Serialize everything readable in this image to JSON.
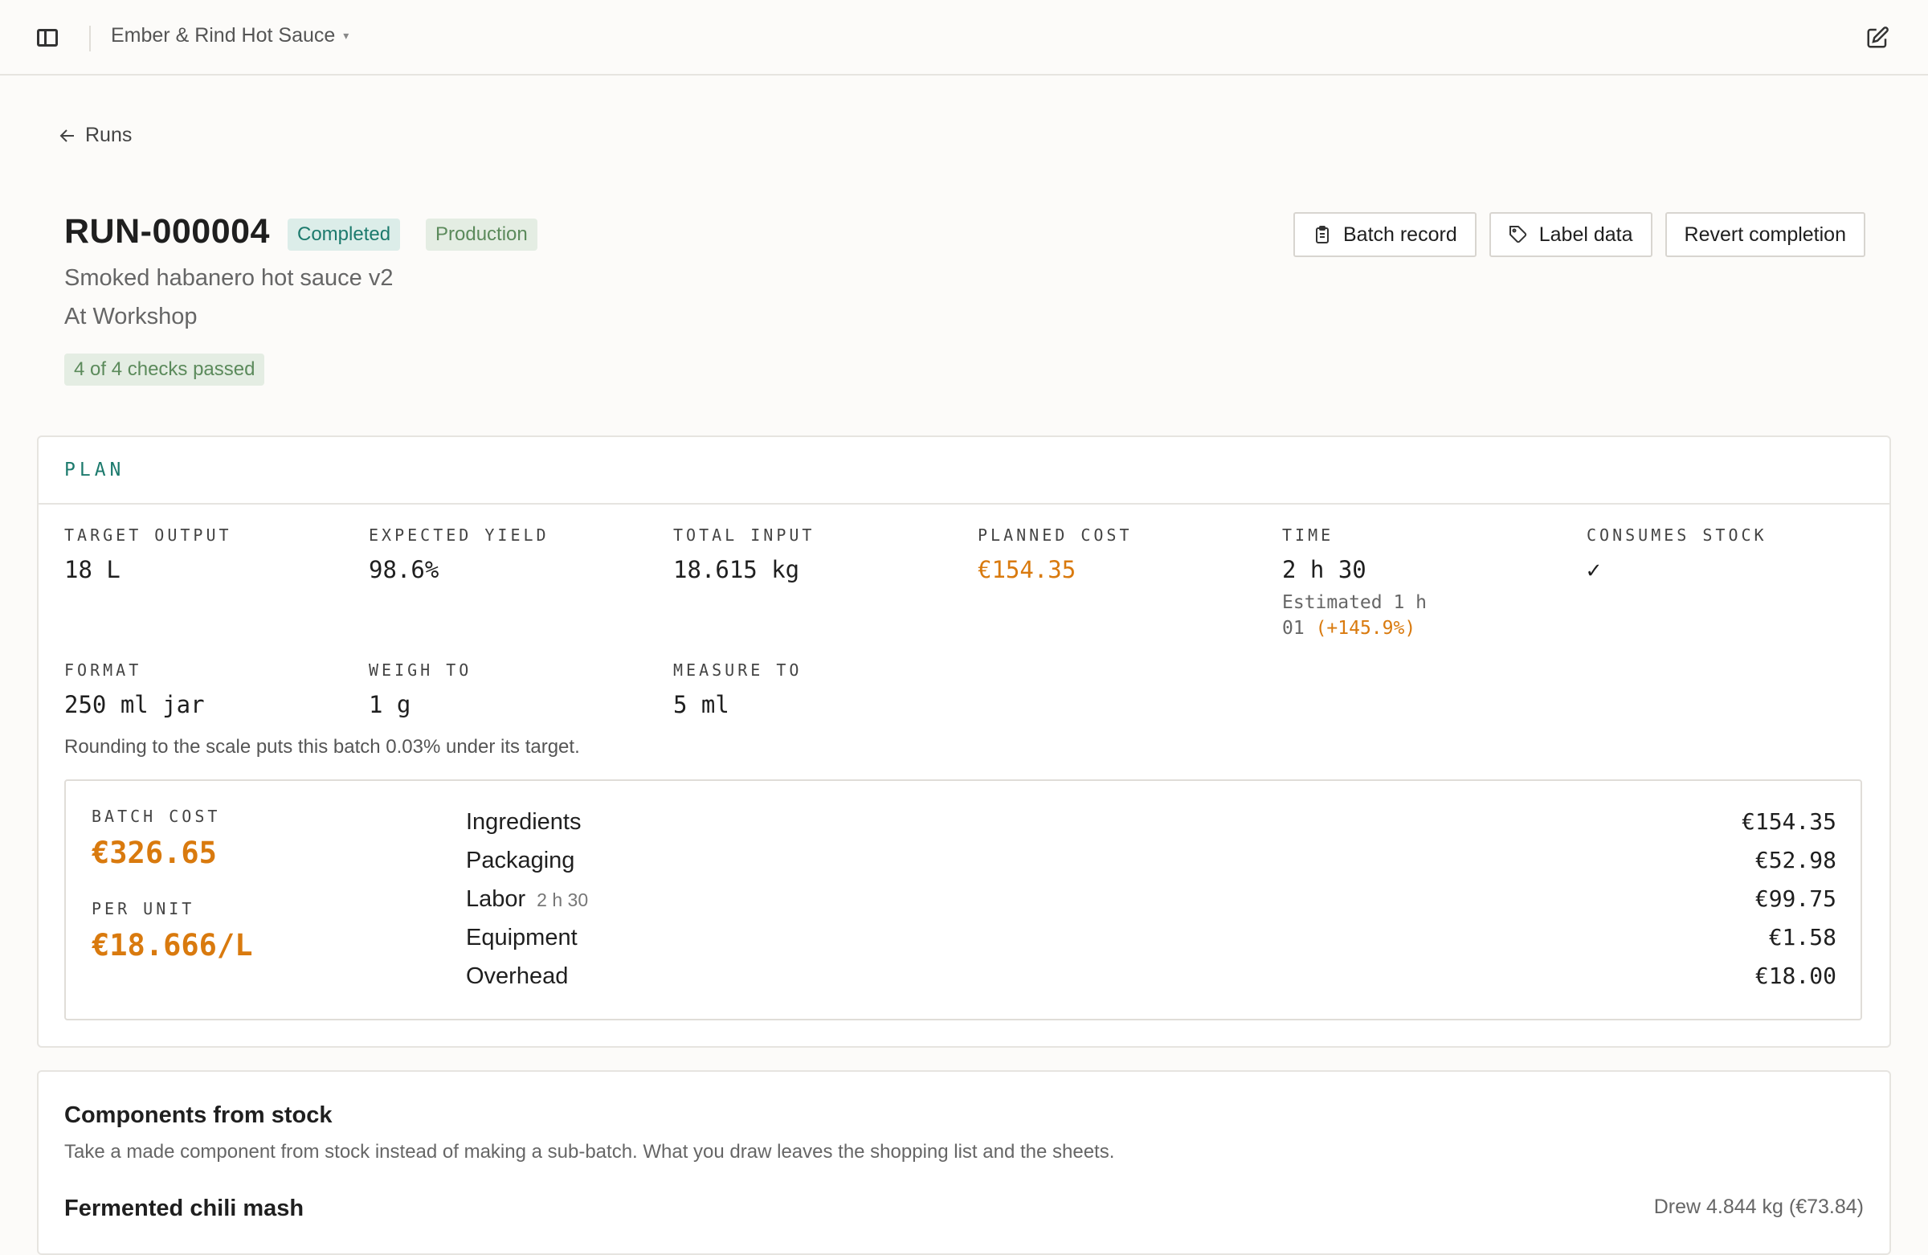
{
  "workspace": {
    "name": "Ember & Rind Hot Sauce",
    "caret": "▾"
  },
  "nav": {
    "back_label": "Runs"
  },
  "run": {
    "id": "RUN-000004",
    "status": "Completed",
    "kind": "Production",
    "recipe": "Smoked habanero hot sauce v2",
    "location": "At Workshop",
    "checks": "4 of 4 checks passed"
  },
  "actions": {
    "batch_record": "Batch record",
    "label_data": "Label data",
    "revert": "Revert completion"
  },
  "plan": {
    "heading": "PLAN",
    "target_output": {
      "label": "TARGET OUTPUT",
      "value": "18 L"
    },
    "expected_yield": {
      "label": "EXPECTED YIELD",
      "value": "98.6%"
    },
    "total_input": {
      "label": "TOTAL INPUT",
      "value": "18.615 kg"
    },
    "planned_cost": {
      "label": "PLANNED COST",
      "value": "€154.35"
    },
    "time": {
      "label": "TIME",
      "value": "2 h 30",
      "estimate": "Estimated 1 h 01",
      "delta": "(+145.9%)"
    },
    "consumes_stock": {
      "label": "CONSUMES STOCK",
      "value": "✓"
    },
    "format": {
      "label": "FORMAT",
      "value": "250 ml jar"
    },
    "weigh_to": {
      "label": "WEIGH TO",
      "value": "1 g"
    },
    "measure_to": {
      "label": "MEASURE TO",
      "value": "5 ml"
    },
    "rounding_note": "Rounding to the scale puts this batch 0.03% under its target."
  },
  "cost": {
    "batch_label": "BATCH COST",
    "batch_value": "€326.65",
    "unit_label": "PER UNIT",
    "unit_value": "€18.666/L",
    "lines": [
      {
        "name": "Ingredients",
        "sub": "",
        "amount": "€154.35"
      },
      {
        "name": "Packaging",
        "sub": "",
        "amount": "€52.98"
      },
      {
        "name": "Labor",
        "sub": "2 h 30",
        "amount": "€99.75"
      },
      {
        "name": "Equipment",
        "sub": "",
        "amount": "€1.58"
      },
      {
        "name": "Overhead",
        "sub": "",
        "amount": "€18.00"
      }
    ]
  },
  "stock": {
    "title": "Components from stock",
    "description": "Take a made component from stock instead of making a sub-batch. What you draw leaves the shopping list and the sheets.",
    "item_name": "Fermented chili mash",
    "item_drew": "Drew 4.844 kg (€73.84)"
  },
  "colors": {
    "accent_teal": "#1c7a6d",
    "accent_orange": "#d97a0e",
    "badge_green": "#5b8a5b"
  }
}
